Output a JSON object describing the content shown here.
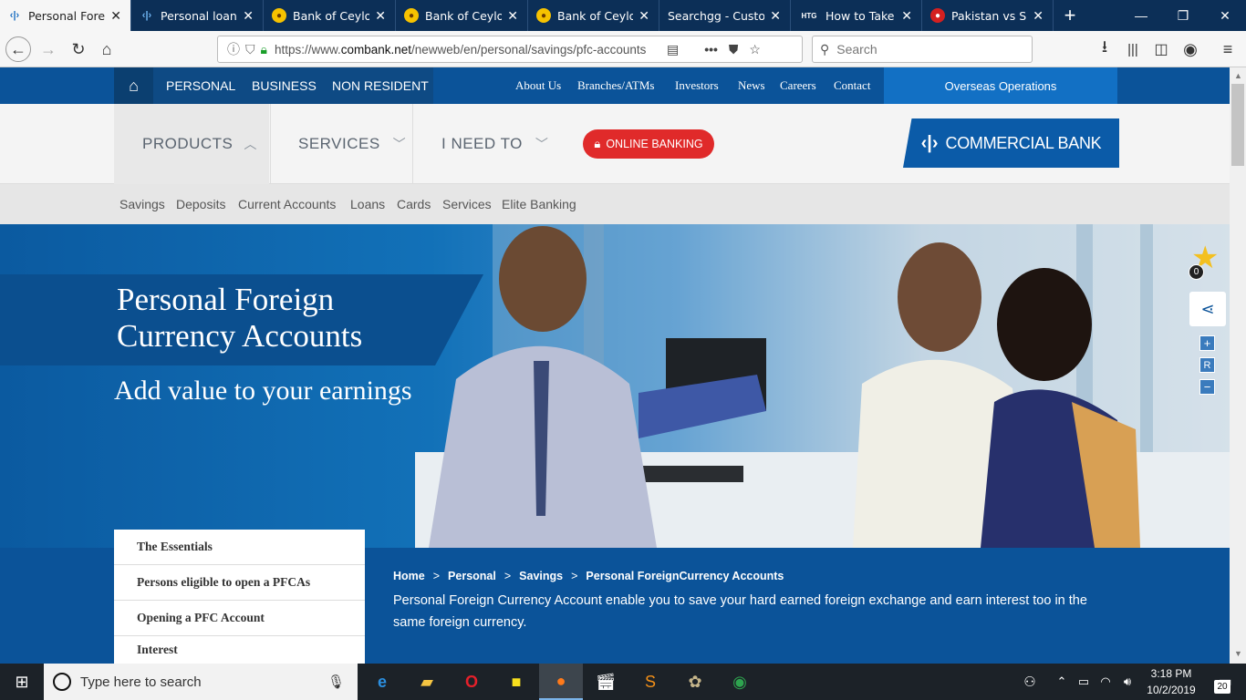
{
  "browser": {
    "tabs": [
      {
        "title": "Personal Foreign Currency Accounts",
        "icon": "combank-icon",
        "active": true
      },
      {
        "title": "Personal loan | Personal",
        "icon": "combank-icon",
        "active": false
      },
      {
        "title": "Bank of Ceylon",
        "icon": "boc-icon",
        "active": false
      },
      {
        "title": "Bank of Ceylon",
        "icon": "boc-icon",
        "active": false
      },
      {
        "title": "Bank of Ceylon",
        "icon": "boc-icon",
        "active": false
      },
      {
        "title": "Searchgg - Customized",
        "icon": "",
        "active": false
      },
      {
        "title": "How to Take Screenshots",
        "icon": "htg-icon",
        "active": false
      },
      {
        "title": "Pakistan vs Sri Lanka",
        "icon": "cricket-icon",
        "active": false
      }
    ],
    "htg_label": "HTG",
    "url_prefix": "https://www.",
    "url_domain": "combank.net",
    "url_path": "/newweb/en/personal/savings/pfc-accounts",
    "search_placeholder": "Search"
  },
  "site": {
    "top_nav": {
      "personal": "PERSONAL",
      "business": "BUSINESS",
      "non_resident": "NON RESIDENT"
    },
    "top_links": [
      "About Us",
      "Branches/ATMs",
      "Investors",
      "News",
      "Careers",
      "Contact"
    ],
    "overseas": "Overseas Operations",
    "main_nav": {
      "products": "PRODUCTS",
      "services": "SERVICES",
      "i_need_to": "I NEED TO"
    },
    "online_banking": "ONLINE BANKING",
    "logo_text": "COMMERCIAL BANK",
    "sub_nav": [
      "Savings",
      "Deposits",
      "Current Accounts",
      "Loans",
      "Cards",
      "Services",
      "Elite Banking"
    ],
    "hero": {
      "title_line1": "Personal Foreign",
      "title_line2": "Currency Accounts",
      "subtitle": "Add value to your earnings"
    },
    "favourite_count": "0",
    "zoom": {
      "plus": "+",
      "reset": "R",
      "minus": "−"
    },
    "side_menu": [
      "The Essentials",
      "Persons eligible to open a PFCAs",
      "Opening a PFC Account",
      "Interest"
    ],
    "breadcrumb": [
      "Home",
      "Personal",
      "Savings",
      "Personal ForeignCurrency Accounts"
    ],
    "breadcrumb_sep": ">",
    "intro_text": "Personal Foreign Currency Account enable you to save your hard earned foreign exchange and earn interest too in the same foreign currency."
  },
  "taskbar": {
    "search_placeholder": "Type here to search",
    "time": "3:18 PM",
    "date": "10/2/2019",
    "notification_count": "20"
  },
  "colors": {
    "brand_blue": "#0b5399",
    "online_red": "#e02a2a",
    "tab_bar": "#0c2f57"
  }
}
